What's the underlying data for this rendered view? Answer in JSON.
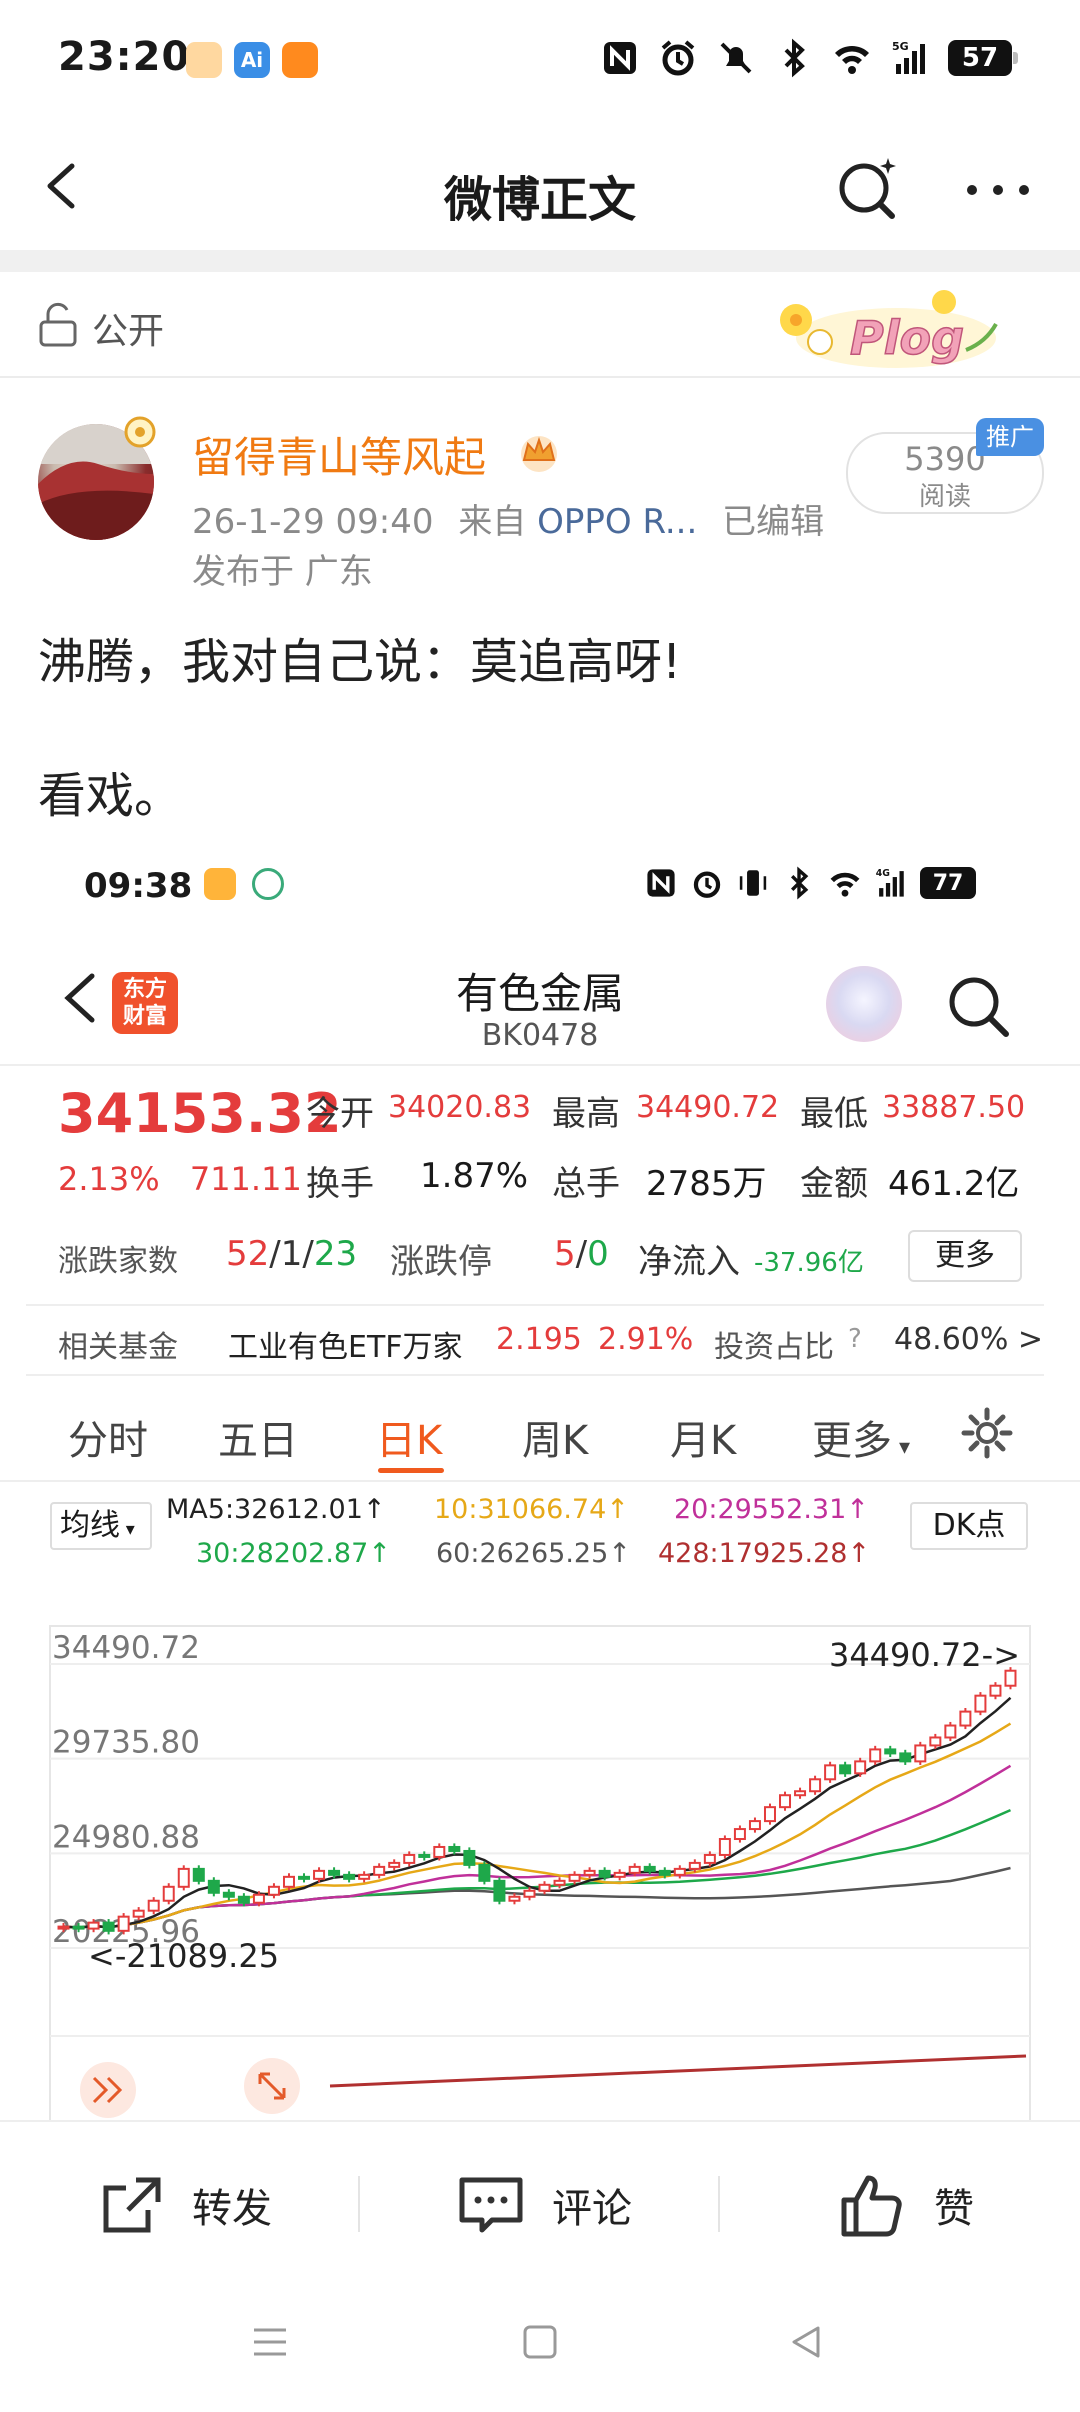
{
  "status_bar": {
    "time": "23:20",
    "battery": "57",
    "network": "5G"
  },
  "header": {
    "title": "微博正文"
  },
  "visibility": {
    "label": "公开",
    "sticker_text": "Plog"
  },
  "post": {
    "username": "留得青山等风起",
    "time": "26-1-29 09:40",
    "source_prefix": "来自",
    "source": "OPPO R...",
    "edited": "已编辑",
    "location": "发布于 广东",
    "read_count": "5390",
    "read_label": "阅读",
    "promo_badge": "推广",
    "text_line1": "沸腾，我对自己说：莫追高呀!",
    "text_line2": "看戏。"
  },
  "embedded": {
    "status_time": "09:38",
    "status_battery": "77",
    "status_network": "4G",
    "app_logo_line1": "东方",
    "app_logo_line2": "财富",
    "title": "有色金属",
    "code": "BK0478",
    "quote": {
      "price": "34153.32",
      "change_pct": "2.13%",
      "change_abs": "711.11",
      "open_label": "今开",
      "open": "34020.83",
      "high_label": "最高",
      "high": "34490.72",
      "low_label": "最低",
      "low": "33887.50",
      "turnover_label": "换手",
      "turnover": "1.87%",
      "volume_label": "总手",
      "volume": "2785万",
      "amount_label": "金额",
      "amount": "461.2亿"
    },
    "stats": {
      "breadth_label": "涨跌家数",
      "up": "52",
      "flat": "1",
      "down": "23",
      "limit_label": "涨跌停",
      "limit_up": "5",
      "limit_down": "0",
      "netflow_label": "净流入",
      "netflow": "-37.96亿",
      "more_label": "更多"
    },
    "fund": {
      "label": "相关基金",
      "name": "工业有色ETF万家",
      "price": "2.195",
      "pct": "2.91%",
      "ratio_label": "投资占比",
      "ratio": "48.60% >"
    },
    "tabs": [
      "分时",
      "五日",
      "日K",
      "周K",
      "月K",
      "更多"
    ],
    "active_tab": "日K",
    "ma": {
      "selector": "均线",
      "ma5": "MA5:32612.01↑",
      "ma10": "10:31066.74↑",
      "ma20": "20:29552.31↑",
      "ma30": "30:28202.87↑",
      "ma60": "60:26265.25↑",
      "ma428": "428:17925.28↑",
      "dk_button": "DK点"
    },
    "chart_data": {
      "type": "candlestick",
      "y_ticks": [
        "34490.72",
        "29735.80",
        "24980.88",
        "20225.96"
      ],
      "ylim": [
        20225.96,
        34490.72
      ],
      "annotation_high": "34490.72->",
      "annotation_low": "<-21089.25",
      "close": [
        21300,
        21200,
        21500,
        21089.25,
        21800,
        22100,
        22600,
        23300,
        24200,
        23600,
        23000,
        22800,
        22500,
        22900,
        23300,
        23800,
        23700,
        24100,
        23900,
        23700,
        23900,
        24300,
        24500,
        24900,
        24800,
        25300,
        25100,
        24400,
        23600,
        22600,
        22800,
        23100,
        23400,
        23600,
        23900,
        24100,
        23800,
        24000,
        24300,
        24100,
        23900,
        24200,
        24500,
        24900,
        25700,
        26200,
        26600,
        27300,
        27900,
        28100,
        28700,
        29400,
        29000,
        29600,
        30200,
        30000,
        29600,
        30400,
        30800,
        31400,
        32100,
        32900,
        33400,
        34153.32
      ]
    }
  },
  "actions": {
    "repost": "转发",
    "comment": "评论",
    "like": "赞"
  },
  "colors": {
    "brand_orange": "#f07a12",
    "rise_red": "#e43c3c",
    "fall_green": "#1ea84a",
    "tab_accent": "#f05a1e"
  }
}
